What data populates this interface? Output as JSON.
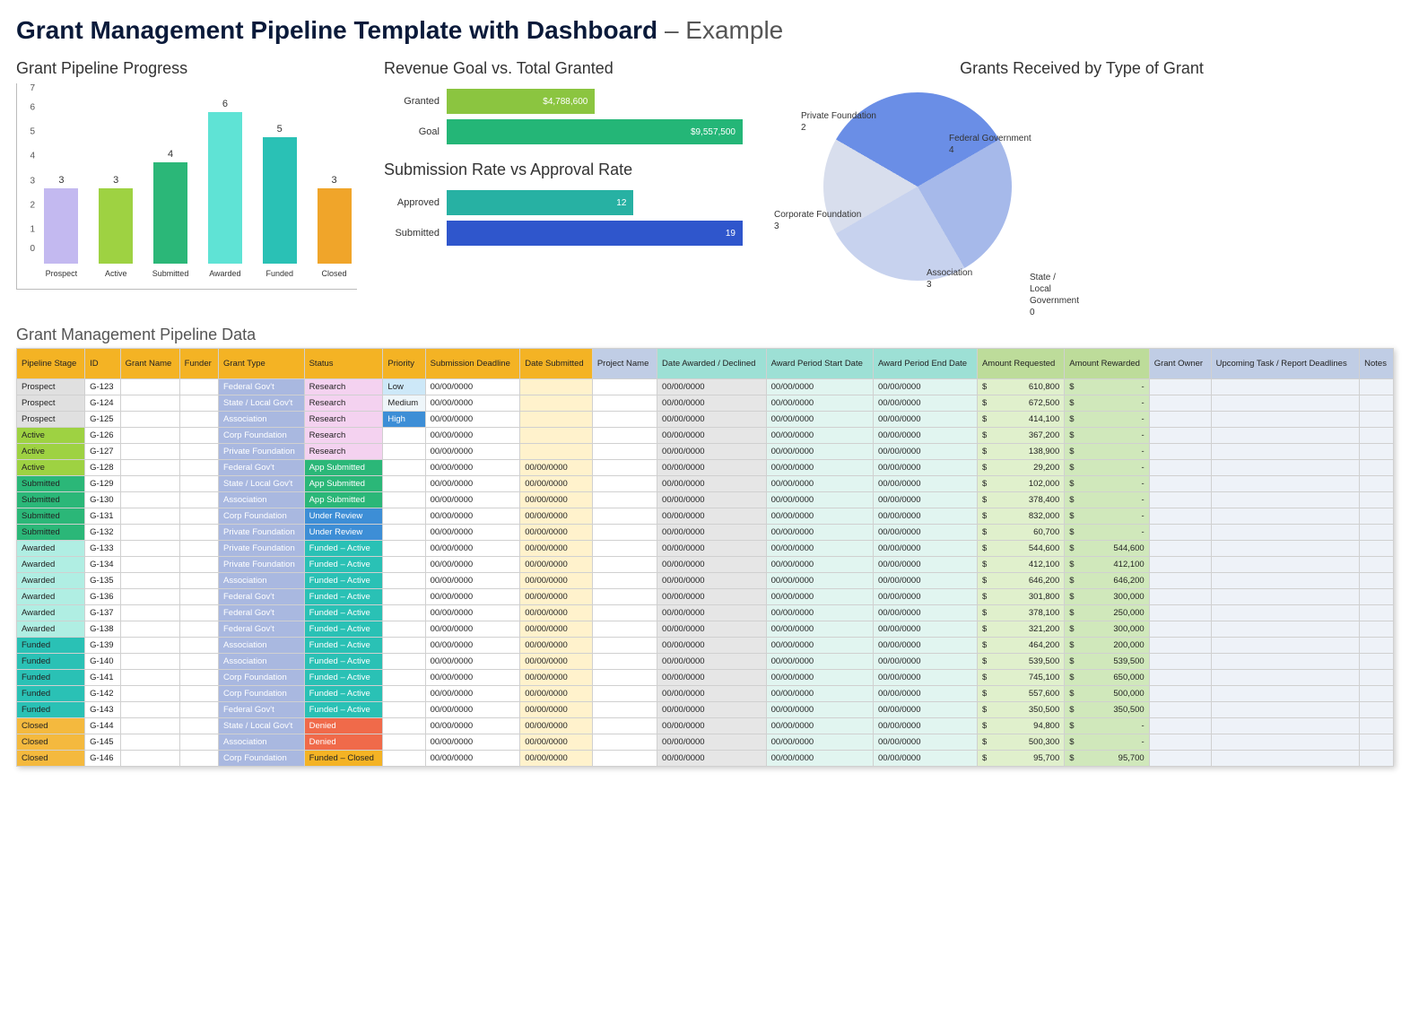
{
  "title_main": "Grant Management Pipeline Template with Dashboard",
  "title_suffix": " – Example",
  "chart_data": [
    {
      "type": "bar",
      "title": "Grant Pipeline Progress",
      "categories": [
        "Prospect",
        "Active",
        "Submitted",
        "Awarded",
        "Funded",
        "Closed"
      ],
      "values": [
        3,
        3,
        4,
        6,
        5,
        3
      ],
      "colors": [
        "#c3b9f0",
        "#9ed242",
        "#2bb778",
        "#5fe3d5",
        "#2ac1b5",
        "#f0a52a"
      ],
      "ylim": [
        0,
        7
      ]
    },
    {
      "type": "bar",
      "orientation": "horizontal",
      "title": "Revenue Goal vs. Total Granted",
      "categories": [
        "Granted",
        "Goal"
      ],
      "values": [
        4788600,
        9557500
      ],
      "labels": [
        "$4,788,600",
        "$9,557,500"
      ],
      "colors": [
        "#8bc540",
        "#24b677"
      ]
    },
    {
      "type": "bar",
      "orientation": "horizontal",
      "title": "Submission Rate vs Approval Rate",
      "categories": [
        "Approved",
        "Submitted"
      ],
      "values": [
        12,
        19
      ],
      "labels": [
        "12",
        "19"
      ],
      "colors": [
        "#27b1a3",
        "#2f56cc"
      ]
    },
    {
      "type": "pie",
      "title": "Grants Received by Type of Grant",
      "series": [
        {
          "name": "Federal Government",
          "value": 4,
          "color": "#6a8ee6"
        },
        {
          "name": "Association",
          "value": 3,
          "color": "#a6b9ea"
        },
        {
          "name": "Corporate Foundation",
          "value": 3,
          "color": "#c7d2ee"
        },
        {
          "name": "Private Foundation",
          "value": 2,
          "color": "#d8deed"
        },
        {
          "name": "State / Local Government",
          "value": 0,
          "color": "#8aa3e8"
        }
      ]
    }
  ],
  "table_title": "Grant Management Pipeline Data",
  "columns": [
    {
      "label": "Pipeline Stage",
      "hbg": "#f4b324"
    },
    {
      "label": "ID",
      "hbg": "#f4b324"
    },
    {
      "label": "Grant Name",
      "hbg": "#f4b324"
    },
    {
      "label": "Funder",
      "hbg": "#f4b324"
    },
    {
      "label": "Grant Type",
      "hbg": "#f4b324"
    },
    {
      "label": "Status",
      "hbg": "#f4b324"
    },
    {
      "label": "Priority",
      "hbg": "#f4b324"
    },
    {
      "label": "Submission Deadline",
      "hbg": "#f4b324"
    },
    {
      "label": "Date Submitted",
      "hbg": "#f4b324"
    },
    {
      "label": "Project Name",
      "hbg": "#c0cde5"
    },
    {
      "label": "Date Awarded / Declined",
      "hbg": "#9de0d5"
    },
    {
      "label": "Award Period Start Date",
      "hbg": "#9de0d5"
    },
    {
      "label": "Award Period End Date",
      "hbg": "#9de0d5"
    },
    {
      "label": "Amount Requested",
      "hbg": "#bddc9a"
    },
    {
      "label": "Amount Rewarded",
      "hbg": "#bddc9a"
    },
    {
      "label": "Grant Owner",
      "hbg": "#c0cde5"
    },
    {
      "label": "Upcoming Task / Report Deadlines",
      "hbg": "#c0cde5"
    },
    {
      "label": "Notes",
      "hbg": "#c0cde5"
    }
  ],
  "stage_colors": {
    "Prospect": "#e0e0e0",
    "Active": "#9ed242",
    "Submitted": "#2bb778",
    "Awarded": "#b0eee3",
    "Funded": "#2ac1b5",
    "Closed": "#f4b93e"
  },
  "status_colors": {
    "Research": "#f4d2f0",
    "App Submitted": "#2bb778",
    "Under Review": "#3d8ed6",
    "Funded – Active": "#2ac1b5",
    "Denied": "#f06a4a",
    "Funded – Closed": "#f4b324"
  },
  "priority_colors": {
    "Low": "#cde8f8",
    "Medium": "#eef6fa",
    "High": "#3d8ed6"
  },
  "rows": [
    {
      "stage": "Prospect",
      "id": "G-123",
      "type": "Federal Gov't",
      "status": "Research",
      "priority": "Low",
      "sub": "00/00/0000",
      "dsub": "",
      "awd": "00/00/0000",
      "ps": "00/00/0000",
      "pe": "00/00/0000",
      "req": "610,800",
      "rew": "-"
    },
    {
      "stage": "Prospect",
      "id": "G-124",
      "type": "State / Local Gov't",
      "status": "Research",
      "priority": "Medium",
      "sub": "00/00/0000",
      "dsub": "",
      "awd": "00/00/0000",
      "ps": "00/00/0000",
      "pe": "00/00/0000",
      "req": "672,500",
      "rew": "-"
    },
    {
      "stage": "Prospect",
      "id": "G-125",
      "type": "Association",
      "status": "Research",
      "priority": "High",
      "sub": "00/00/0000",
      "dsub": "",
      "awd": "00/00/0000",
      "ps": "00/00/0000",
      "pe": "00/00/0000",
      "req": "414,100",
      "rew": "-"
    },
    {
      "stage": "Active",
      "id": "G-126",
      "type": "Corp Foundation",
      "status": "Research",
      "priority": "",
      "sub": "00/00/0000",
      "dsub": "",
      "awd": "00/00/0000",
      "ps": "00/00/0000",
      "pe": "00/00/0000",
      "req": "367,200",
      "rew": "-"
    },
    {
      "stage": "Active",
      "id": "G-127",
      "type": "Private Foundation",
      "status": "Research",
      "priority": "",
      "sub": "00/00/0000",
      "dsub": "",
      "awd": "00/00/0000",
      "ps": "00/00/0000",
      "pe": "00/00/0000",
      "req": "138,900",
      "rew": "-"
    },
    {
      "stage": "Active",
      "id": "G-128",
      "type": "Federal Gov't",
      "status": "App Submitted",
      "priority": "",
      "sub": "00/00/0000",
      "dsub": "00/00/0000",
      "awd": "00/00/0000",
      "ps": "00/00/0000",
      "pe": "00/00/0000",
      "req": "29,200",
      "rew": "-"
    },
    {
      "stage": "Submitted",
      "id": "G-129",
      "type": "State / Local Gov't",
      "status": "App Submitted",
      "priority": "",
      "sub": "00/00/0000",
      "dsub": "00/00/0000",
      "awd": "00/00/0000",
      "ps": "00/00/0000",
      "pe": "00/00/0000",
      "req": "102,000",
      "rew": "-"
    },
    {
      "stage": "Submitted",
      "id": "G-130",
      "type": "Association",
      "status": "App Submitted",
      "priority": "",
      "sub": "00/00/0000",
      "dsub": "00/00/0000",
      "awd": "00/00/0000",
      "ps": "00/00/0000",
      "pe": "00/00/0000",
      "req": "378,400",
      "rew": "-"
    },
    {
      "stage": "Submitted",
      "id": "G-131",
      "type": "Corp Foundation",
      "status": "Under Review",
      "priority": "",
      "sub": "00/00/0000",
      "dsub": "00/00/0000",
      "awd": "00/00/0000",
      "ps": "00/00/0000",
      "pe": "00/00/0000",
      "req": "832,000",
      "rew": "-"
    },
    {
      "stage": "Submitted",
      "id": "G-132",
      "type": "Private Foundation",
      "status": "Under Review",
      "priority": "",
      "sub": "00/00/0000",
      "dsub": "00/00/0000",
      "awd": "00/00/0000",
      "ps": "00/00/0000",
      "pe": "00/00/0000",
      "req": "60,700",
      "rew": "-"
    },
    {
      "stage": "Awarded",
      "id": "G-133",
      "type": "Private Foundation",
      "status": "Funded – Active",
      "priority": "",
      "sub": "00/00/0000",
      "dsub": "00/00/0000",
      "awd": "00/00/0000",
      "ps": "00/00/0000",
      "pe": "00/00/0000",
      "req": "544,600",
      "rew": "544,600"
    },
    {
      "stage": "Awarded",
      "id": "G-134",
      "type": "Private Foundation",
      "status": "Funded – Active",
      "priority": "",
      "sub": "00/00/0000",
      "dsub": "00/00/0000",
      "awd": "00/00/0000",
      "ps": "00/00/0000",
      "pe": "00/00/0000",
      "req": "412,100",
      "rew": "412,100"
    },
    {
      "stage": "Awarded",
      "id": "G-135",
      "type": "Association",
      "status": "Funded – Active",
      "priority": "",
      "sub": "00/00/0000",
      "dsub": "00/00/0000",
      "awd": "00/00/0000",
      "ps": "00/00/0000",
      "pe": "00/00/0000",
      "req": "646,200",
      "rew": "646,200"
    },
    {
      "stage": "Awarded",
      "id": "G-136",
      "type": "Federal Gov't",
      "status": "Funded – Active",
      "priority": "",
      "sub": "00/00/0000",
      "dsub": "00/00/0000",
      "awd": "00/00/0000",
      "ps": "00/00/0000",
      "pe": "00/00/0000",
      "req": "301,800",
      "rew": "300,000"
    },
    {
      "stage": "Awarded",
      "id": "G-137",
      "type": "Federal Gov't",
      "status": "Funded – Active",
      "priority": "",
      "sub": "00/00/0000",
      "dsub": "00/00/0000",
      "awd": "00/00/0000",
      "ps": "00/00/0000",
      "pe": "00/00/0000",
      "req": "378,100",
      "rew": "250,000"
    },
    {
      "stage": "Awarded",
      "id": "G-138",
      "type": "Federal Gov't",
      "status": "Funded – Active",
      "priority": "",
      "sub": "00/00/0000",
      "dsub": "00/00/0000",
      "awd": "00/00/0000",
      "ps": "00/00/0000",
      "pe": "00/00/0000",
      "req": "321,200",
      "rew": "300,000"
    },
    {
      "stage": "Funded",
      "id": "G-139",
      "type": "Association",
      "status": "Funded – Active",
      "priority": "",
      "sub": "00/00/0000",
      "dsub": "00/00/0000",
      "awd": "00/00/0000",
      "ps": "00/00/0000",
      "pe": "00/00/0000",
      "req": "464,200",
      "rew": "200,000"
    },
    {
      "stage": "Funded",
      "id": "G-140",
      "type": "Association",
      "status": "Funded – Active",
      "priority": "",
      "sub": "00/00/0000",
      "dsub": "00/00/0000",
      "awd": "00/00/0000",
      "ps": "00/00/0000",
      "pe": "00/00/0000",
      "req": "539,500",
      "rew": "539,500"
    },
    {
      "stage": "Funded",
      "id": "G-141",
      "type": "Corp Foundation",
      "status": "Funded – Active",
      "priority": "",
      "sub": "00/00/0000",
      "dsub": "00/00/0000",
      "awd": "00/00/0000",
      "ps": "00/00/0000",
      "pe": "00/00/0000",
      "req": "745,100",
      "rew": "650,000"
    },
    {
      "stage": "Funded",
      "id": "G-142",
      "type": "Corp Foundation",
      "status": "Funded – Active",
      "priority": "",
      "sub": "00/00/0000",
      "dsub": "00/00/0000",
      "awd": "00/00/0000",
      "ps": "00/00/0000",
      "pe": "00/00/0000",
      "req": "557,600",
      "rew": "500,000"
    },
    {
      "stage": "Funded",
      "id": "G-143",
      "type": "Federal Gov't",
      "status": "Funded – Active",
      "priority": "",
      "sub": "00/00/0000",
      "dsub": "00/00/0000",
      "awd": "00/00/0000",
      "ps": "00/00/0000",
      "pe": "00/00/0000",
      "req": "350,500",
      "rew": "350,500"
    },
    {
      "stage": "Closed",
      "id": "G-144",
      "type": "State / Local Gov't",
      "status": "Denied",
      "priority": "",
      "sub": "00/00/0000",
      "dsub": "00/00/0000",
      "awd": "00/00/0000",
      "ps": "00/00/0000",
      "pe": "00/00/0000",
      "req": "94,800",
      "rew": "-"
    },
    {
      "stage": "Closed",
      "id": "G-145",
      "type": "Association",
      "status": "Denied",
      "priority": "",
      "sub": "00/00/0000",
      "dsub": "00/00/0000",
      "awd": "00/00/0000",
      "ps": "00/00/0000",
      "pe": "00/00/0000",
      "req": "500,300",
      "rew": "-"
    },
    {
      "stage": "Closed",
      "id": "G-146",
      "type": "Corp Foundation",
      "status": "Funded – Closed",
      "priority": "",
      "sub": "00/00/0000",
      "dsub": "00/00/0000",
      "awd": "00/00/0000",
      "ps": "00/00/0000",
      "pe": "00/00/0000",
      "req": "95,700",
      "rew": "95,700"
    }
  ]
}
